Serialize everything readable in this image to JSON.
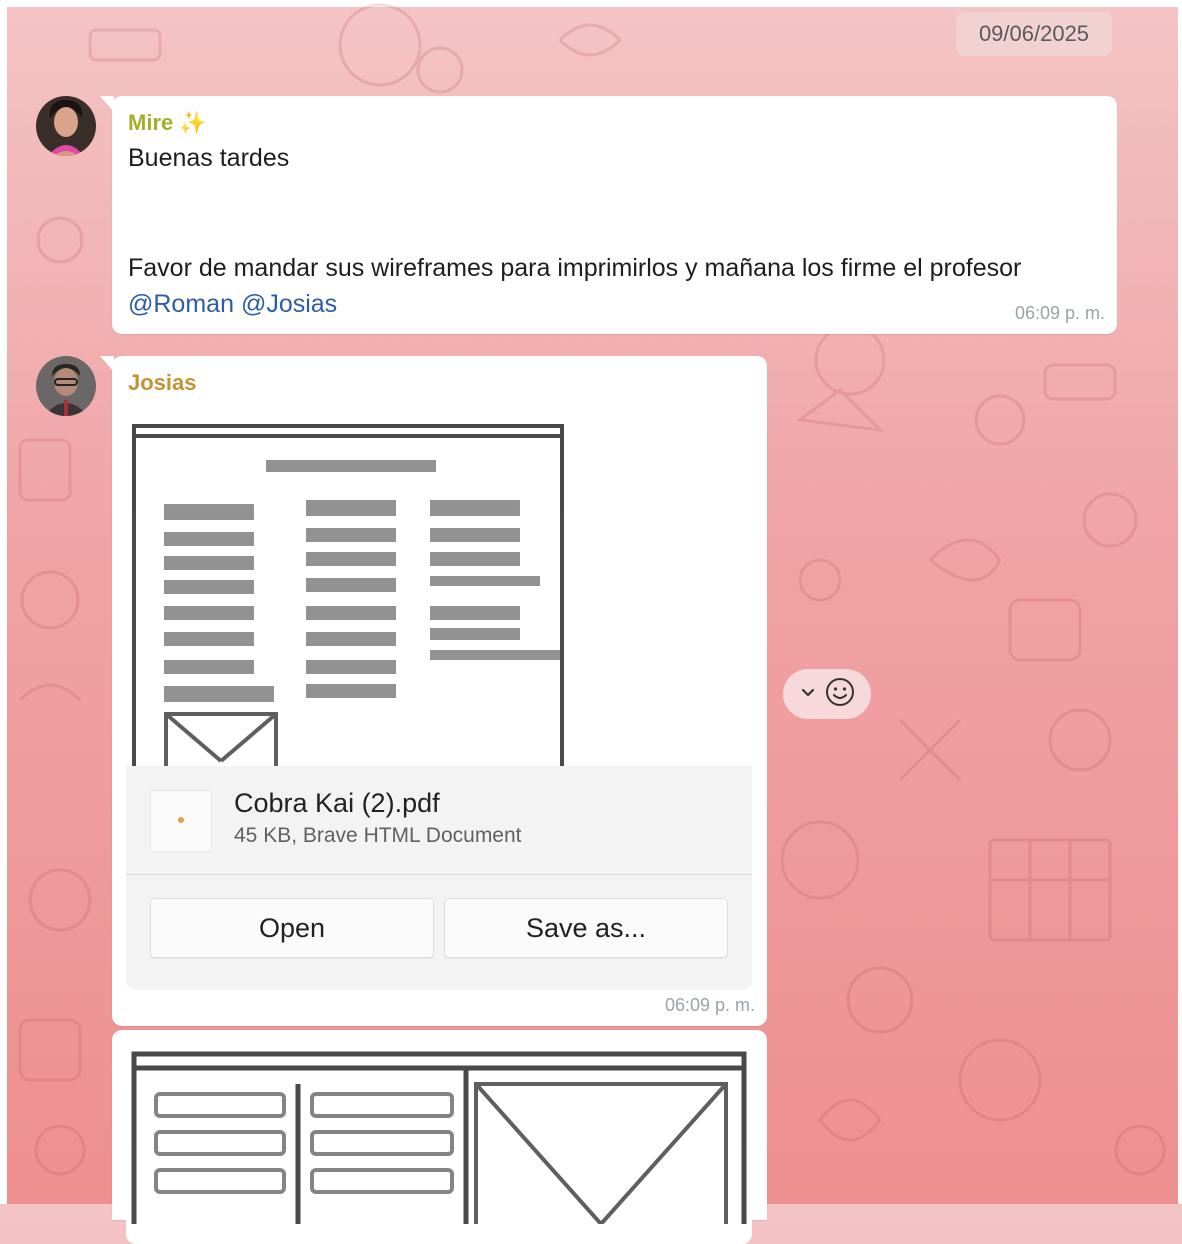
{
  "date_chip": "09/06/2025",
  "messages": [
    {
      "sender": "Mire",
      "sender_suffix": "✨",
      "sender_color": "#a5ae2a",
      "line1": "Buenas tardes",
      "line2": "Favor de mandar sus wireframes para imprimirlos y mañana los firme el profesor",
      "mention1": "@Roman",
      "mention2": "@Josias",
      "time": "06:09 p. m."
    },
    {
      "sender": "Josias",
      "sender_color": "#c59233",
      "file_name": "Cobra Kai (2).pdf",
      "file_meta": "45 KB, Brave HTML Document",
      "open_label": "Open",
      "save_label": "Save as...",
      "time": "06:09 p. m."
    }
  ],
  "icons": {
    "expand": "chevron-down-icon",
    "reaction": "smiley-icon"
  },
  "colors": {
    "mention": "#2a5ea8",
    "bubble": "#ffffff"
  }
}
